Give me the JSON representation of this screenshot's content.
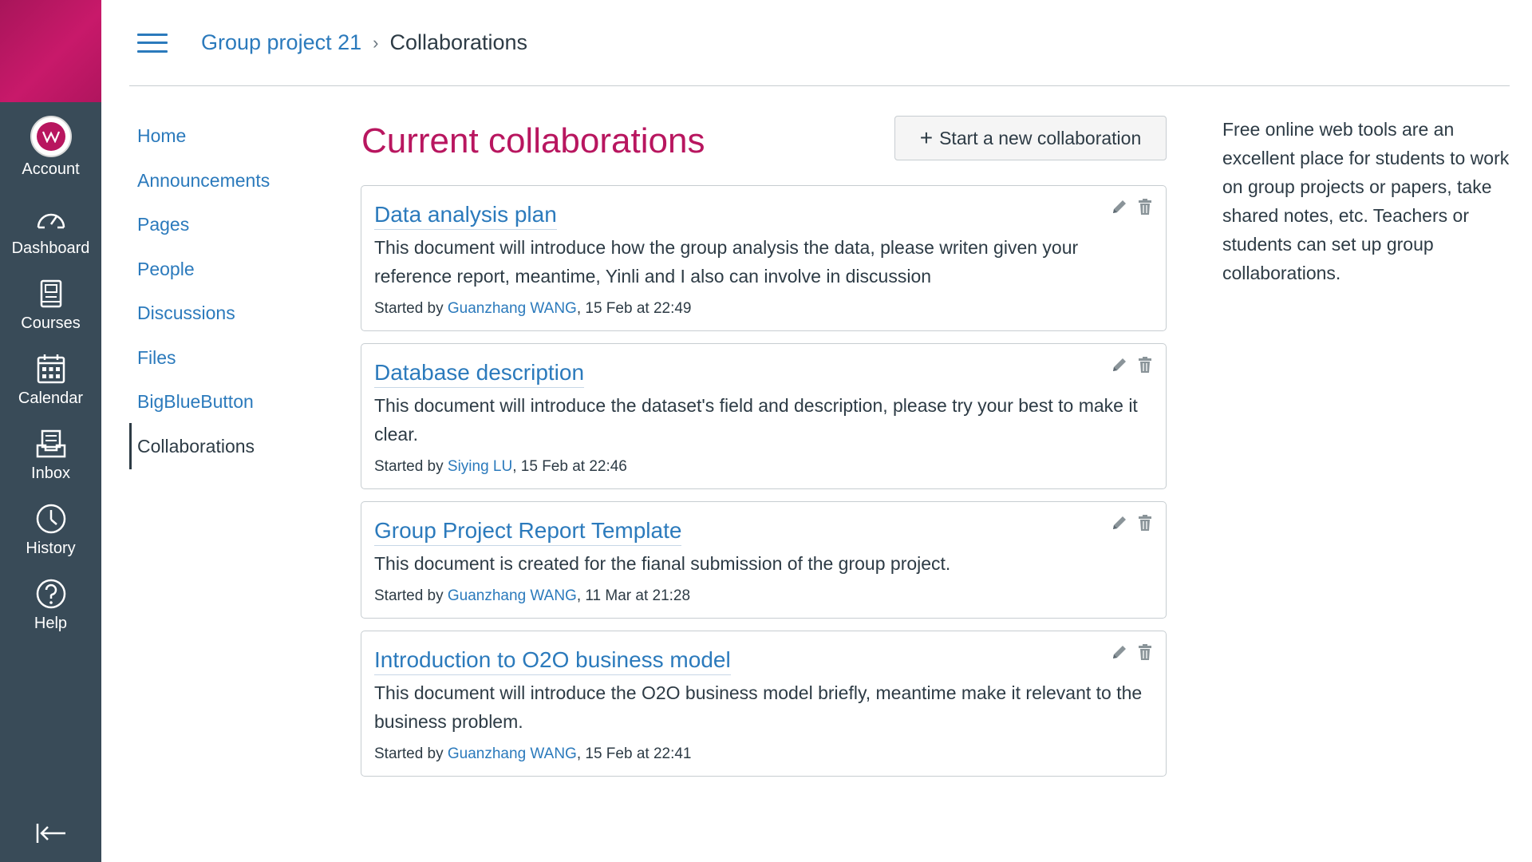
{
  "global_nav": {
    "items": [
      {
        "label": "Account",
        "icon": "avatar"
      },
      {
        "label": "Dashboard",
        "icon": "dashboard-icon"
      },
      {
        "label": "Courses",
        "icon": "courses-icon"
      },
      {
        "label": "Calendar",
        "icon": "calendar-icon"
      },
      {
        "label": "Inbox",
        "icon": "inbox-icon"
      },
      {
        "label": "History",
        "icon": "history-icon"
      },
      {
        "label": "Help",
        "icon": "help-icon"
      }
    ],
    "collapse_icon": "collapse-nav-icon"
  },
  "breadcrumb": {
    "course": "Group project 21",
    "separator": "›",
    "current": "Collaborations"
  },
  "course_nav": {
    "items": [
      {
        "label": "Home"
      },
      {
        "label": "Announcements"
      },
      {
        "label": "Pages"
      },
      {
        "label": "People"
      },
      {
        "label": "Discussions"
      },
      {
        "label": "Files"
      },
      {
        "label": "BigBlueButton"
      },
      {
        "label": "Collaborations",
        "active": true
      }
    ]
  },
  "main": {
    "title": "Current collaborations",
    "new_button_plus": "+",
    "new_button_label": "Start a new collaboration",
    "started_by_prefix": "Started by ",
    "collaborations": [
      {
        "title": "Data analysis plan",
        "description": "This document will introduce how the group analysis the data, please writen given your reference report, meantime, Yinli and I also can involve in discussion",
        "author": "Guanzhang WANG",
        "date": ", 15 Feb at 22:49"
      },
      {
        "title": "Database description",
        "description": "This document will introduce the dataset's field and description, please try your best to make it clear.",
        "author": "Siying LU",
        "date": ", 15 Feb at 22:46"
      },
      {
        "title": "Group Project Report Template",
        "description": "This document is created for the fianal submission of the group project.",
        "author": "Guanzhang WANG",
        "date": ", 11 Mar at 21:28"
      },
      {
        "title": "Introduction to O2O business model",
        "description": "This document will introduce the O2O business model briefly, meantime make it relevant to the business problem.",
        "author": "Guanzhang WANG",
        "date": ", 15 Feb at 22:41"
      }
    ]
  },
  "aside": {
    "text": "Free online web tools are an excellent place for students to work on group projects or papers, take shared notes, etc. Teachers or students can set up group collaborations."
  },
  "colors": {
    "nav_bg": "#394b58",
    "brand": "#b8165f",
    "link": "#2b7abc",
    "text": "#2d3b45"
  }
}
